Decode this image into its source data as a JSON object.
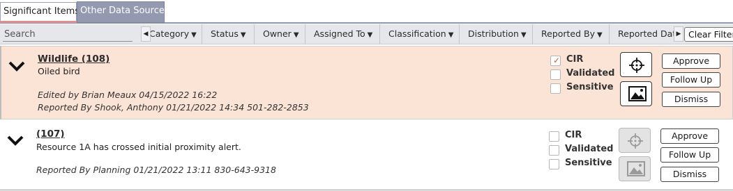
{
  "tabs": [
    {
      "label": "Significant Items",
      "active": true
    },
    {
      "label": "Other Data Sources",
      "active": false
    }
  ],
  "filterbar": {
    "search_placeholder": "Search",
    "filters": [
      "Category",
      "Status",
      "Owner",
      "Assigned To",
      "Classification",
      "Distribution",
      "Reported By",
      "Reported Date"
    ],
    "clear_label": "Clear Filters"
  },
  "items": [
    {
      "title": "Wildlife (108)",
      "description": "Oiled bird",
      "edited_line": "Edited by Brian Meaux 04/15/2022 16:22",
      "reported_line": "Reported By Shook, Anthony 01/21/2022 14:34 501-282-2853",
      "highlighted": true,
      "checks": [
        {
          "label": "CIR",
          "checked": true
        },
        {
          "label": "Validated",
          "checked": false
        },
        {
          "label": "Sensitive",
          "checked": false
        }
      ],
      "actions": [
        "Approve",
        "Follow Up",
        "Dismiss"
      ]
    },
    {
      "title": "(107)",
      "description": "Resource 1A has crossed initial proximity alert.",
      "reported_line": "Reported By Planning 01/21/2022 13:11 830-643-9318",
      "highlighted": false,
      "checks": [
        {
          "label": "CIR",
          "checked": false
        },
        {
          "label": "Validated",
          "checked": false
        },
        {
          "label": "Sensitive",
          "checked": false
        }
      ],
      "actions": [
        "Approve",
        "Follow Up",
        "Dismiss"
      ]
    }
  ],
  "colors": {
    "highlight_row": "#fbe3d6",
    "active_tab_underline": "#e38d8d",
    "inactive_tab": "#939ab0",
    "checkmark": "#d9542b"
  },
  "icons": [
    "chevron-down-icon",
    "crosshair-icon",
    "image-icon",
    "checkmark-icon",
    "arrow-left-icon",
    "arrow-right-icon"
  ]
}
